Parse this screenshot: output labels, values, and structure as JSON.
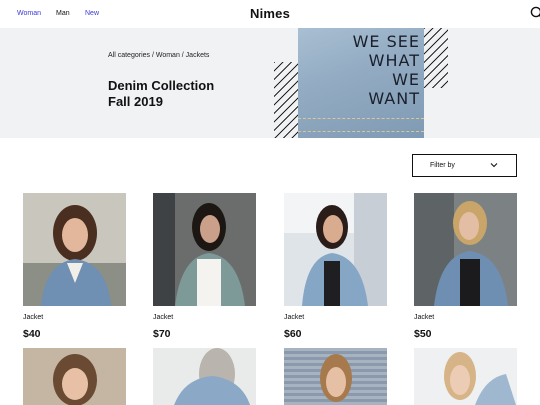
{
  "nav": {
    "links": [
      "Woman",
      "Man",
      "New"
    ],
    "brand": "Nimes"
  },
  "hero": {
    "breadcrumb": "All categories / Woman / Jackets",
    "title": "Denim Collection\nFall 2019",
    "image_text": "WE SEE\nWHAT\nWE\nWANT"
  },
  "filter": {
    "label": "Filter by"
  },
  "products": [
    {
      "category": "Jacket",
      "price": "$40"
    },
    {
      "category": "Jacket",
      "price": "$70"
    },
    {
      "category": "Jacket",
      "price": "$60"
    },
    {
      "category": "Jacket",
      "price": "$50"
    }
  ],
  "colors": {
    "accent": "#3a3ad6",
    "hero_bg": "#f1f2f3",
    "text": "#111111"
  },
  "icons": {
    "search": "search-icon",
    "filter_chevron": "chevron-down-icon"
  }
}
